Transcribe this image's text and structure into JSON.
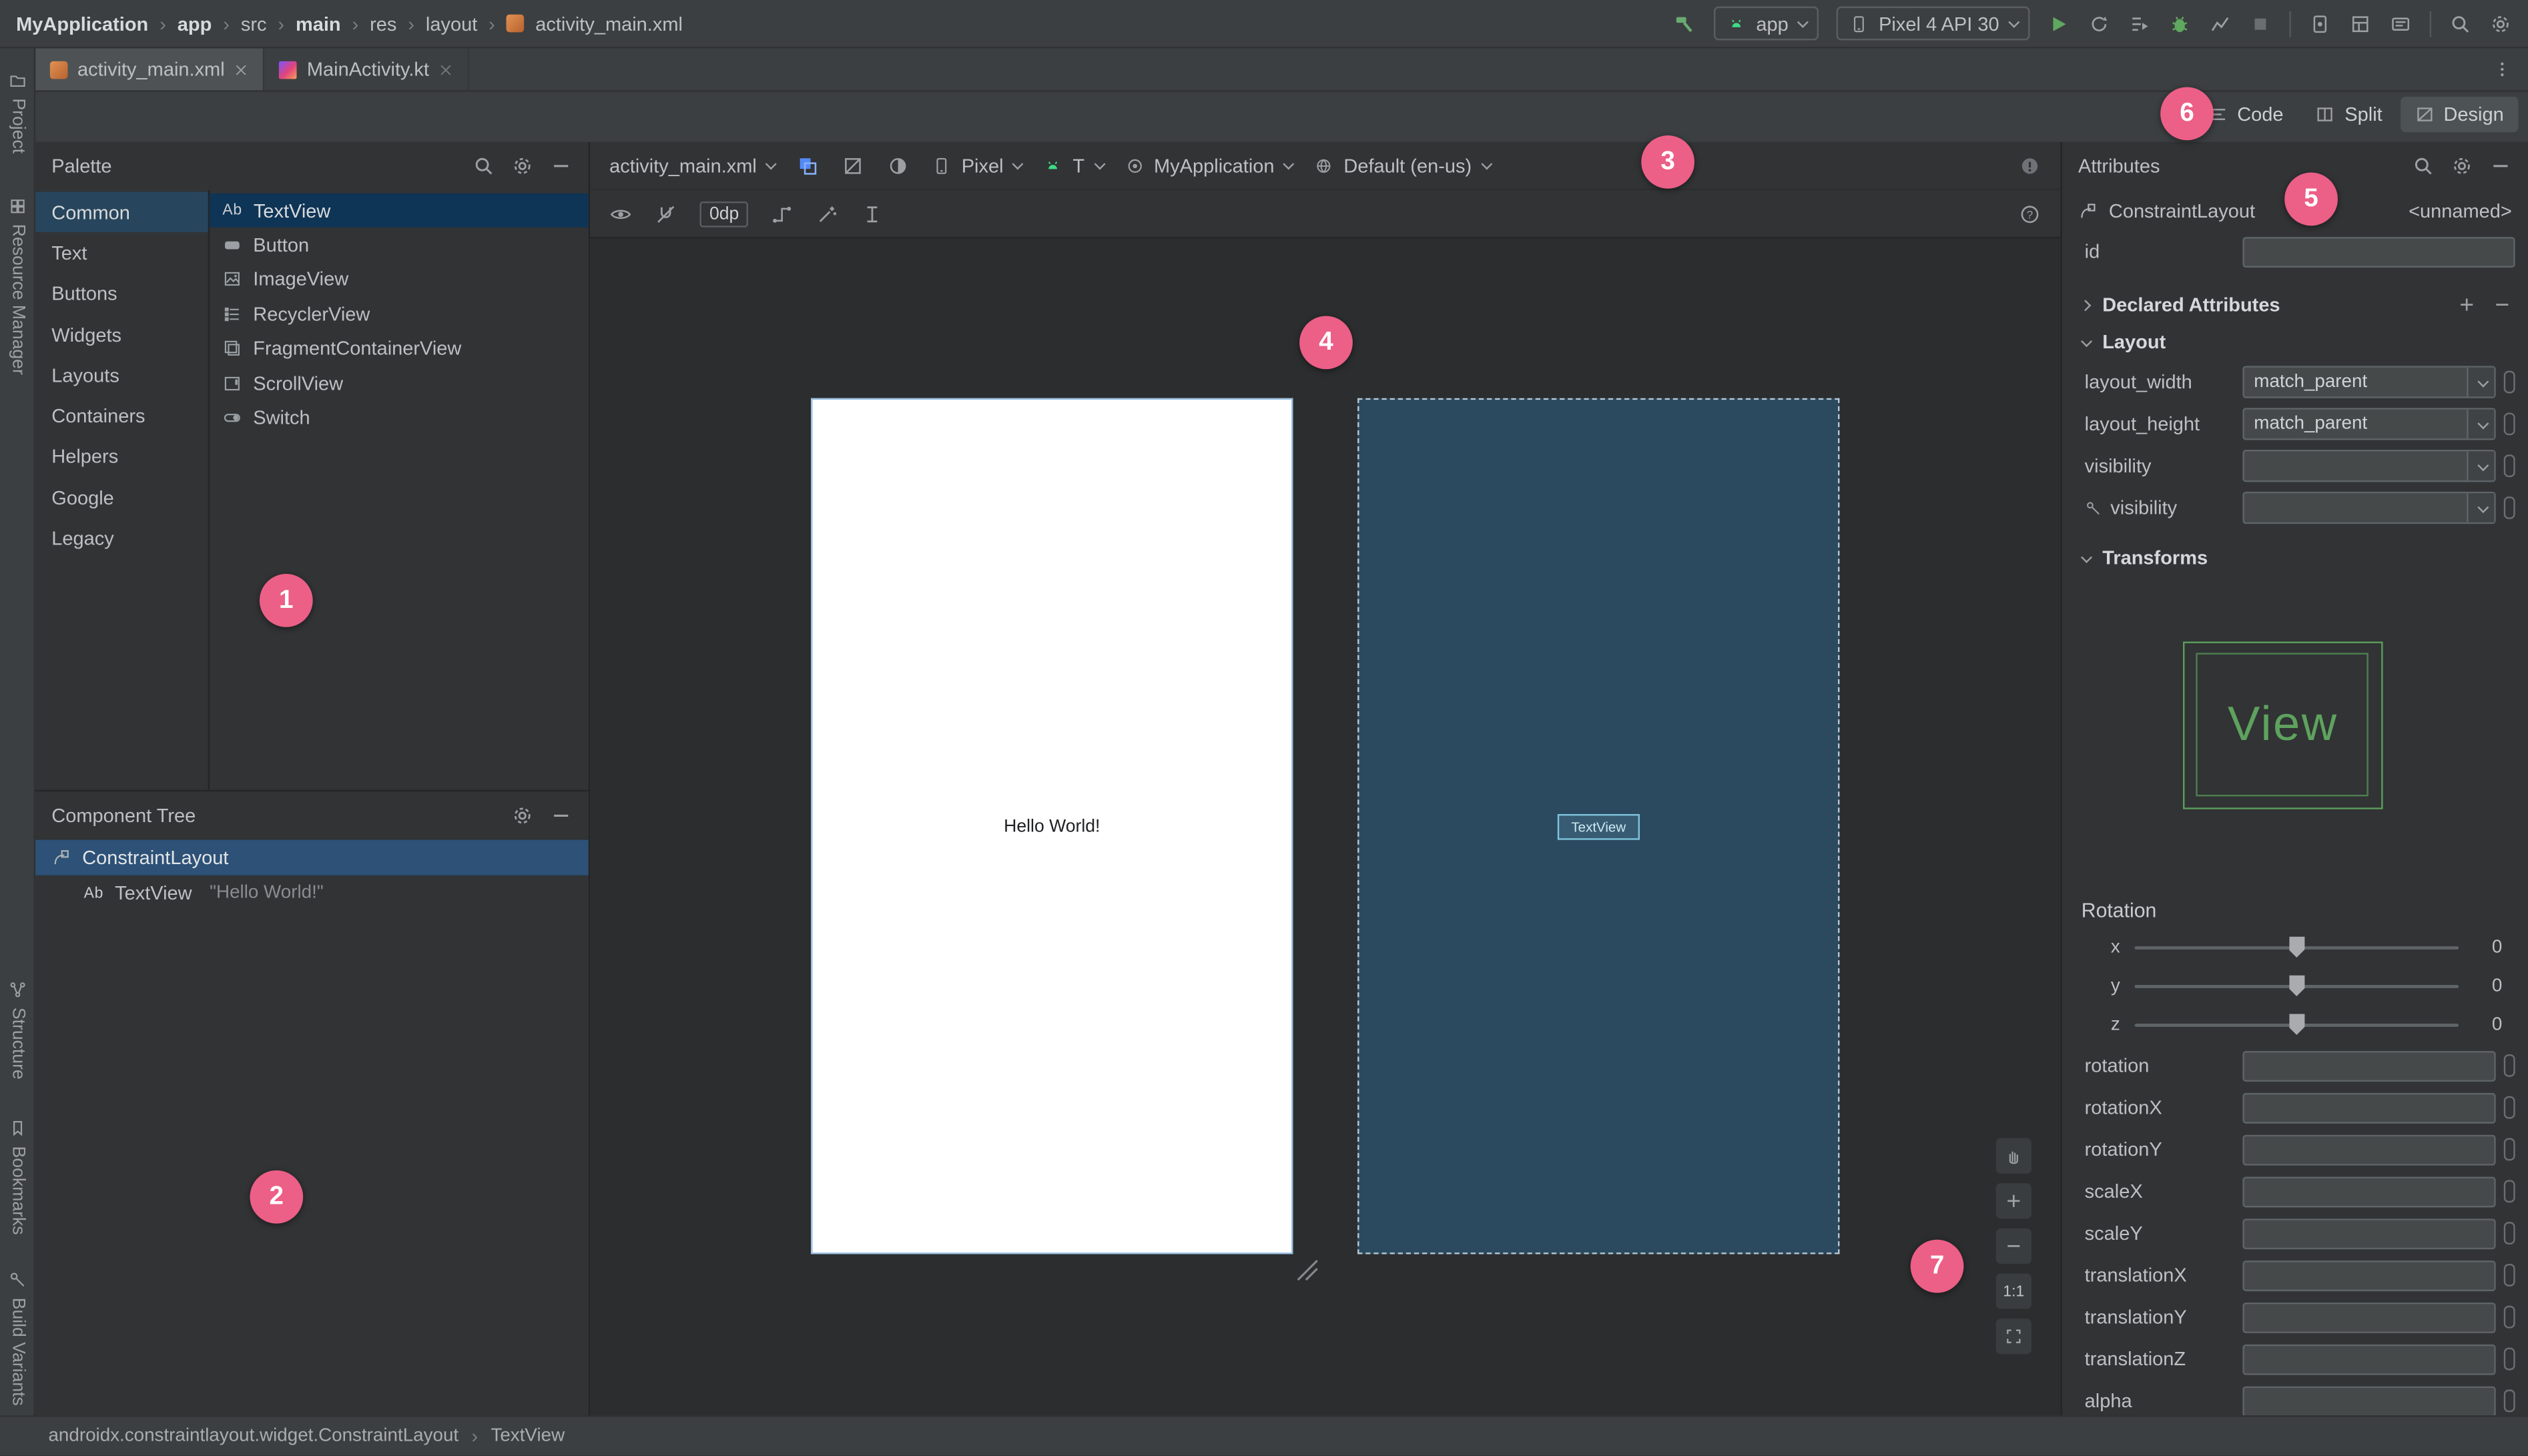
{
  "breadcrumb": {
    "items": [
      "MyApplication",
      "app",
      "src",
      "main",
      "res",
      "layout",
      "activity_main.xml"
    ]
  },
  "run_toolbar": {
    "config": "app",
    "device": "Pixel 4 API 30"
  },
  "editor_tabs": [
    {
      "label": "activity_main.xml"
    },
    {
      "label": "MainActivity.kt"
    }
  ],
  "tool_stripes": {
    "left_top": [
      "Project",
      "Resource Manager"
    ],
    "left_bottom": [
      "Structure",
      "Bookmarks",
      "Build Variants"
    ]
  },
  "view_modes": {
    "options": [
      {
        "label": "Code"
      },
      {
        "label": "Split"
      },
      {
        "label": "Design"
      }
    ],
    "selected": "Design"
  },
  "palette": {
    "title": "Palette",
    "categories": [
      {
        "label": "Common"
      },
      {
        "label": "Text"
      },
      {
        "label": "Buttons"
      },
      {
        "label": "Widgets"
      },
      {
        "label": "Layouts"
      },
      {
        "label": "Containers"
      },
      {
        "label": "Helpers"
      },
      {
        "label": "Google"
      },
      {
        "label": "Legacy"
      }
    ],
    "selected_category": "Common",
    "items": [
      {
        "label": "TextView"
      },
      {
        "label": "Button"
      },
      {
        "label": "ImageView"
      },
      {
        "label": "RecyclerView"
      },
      {
        "label": "FragmentContainerView"
      },
      {
        "label": "ScrollView"
      },
      {
        "label": "Switch"
      }
    ],
    "selected_item": "TextView",
    "textview_icon": "Ab"
  },
  "component_tree": {
    "title": "Component Tree",
    "rows": [
      {
        "label": "ConstraintLayout",
        "detail": ""
      },
      {
        "label": "TextView",
        "detail": "\"Hello World!\"",
        "icon": "Ab"
      }
    ]
  },
  "design_toolbar": {
    "file": "activity_main.xml",
    "device": "Pixel",
    "api": "T",
    "theme": "MyApplication",
    "locale": "Default (en-us)",
    "margin": "0dp"
  },
  "canvas": {
    "design_preview_text": "Hello World!",
    "blueprint_widget_label": "TextView",
    "zoom_label": "1:1"
  },
  "attributes": {
    "title": "Attributes",
    "component": "ConstraintLayout",
    "component_id": "<unnamed>",
    "id_label": "id",
    "id_value": "",
    "declared_attributes_label": "Declared Attributes",
    "layout_section": "Layout",
    "layout_rows": [
      {
        "label": "layout_width",
        "value": "match_parent"
      },
      {
        "label": "layout_height",
        "value": "match_parent"
      },
      {
        "label": "visibility",
        "value": ""
      },
      {
        "label": "visibility",
        "value": ""
      }
    ],
    "transforms_section": "Transforms",
    "view_preview_label": "View",
    "rotation_label": "Rotation",
    "sliders": [
      {
        "axis": "x",
        "value": "0"
      },
      {
        "axis": "y",
        "value": "0"
      },
      {
        "axis": "z",
        "value": "0"
      }
    ],
    "transform_fields": [
      {
        "label": "rotation"
      },
      {
        "label": "rotationX"
      },
      {
        "label": "rotationY"
      },
      {
        "label": "scaleX"
      },
      {
        "label": "scaleY"
      },
      {
        "label": "translationX"
      },
      {
        "label": "translationY"
      },
      {
        "label": "translationZ"
      },
      {
        "label": "alpha"
      }
    ]
  },
  "status_bar": {
    "path": "androidx.constraintlayout.widget.ConstraintLayout",
    "node": "TextView"
  },
  "badges": [
    {
      "n": "1"
    },
    {
      "n": "2"
    },
    {
      "n": "3"
    },
    {
      "n": "4"
    },
    {
      "n": "5"
    },
    {
      "n": "6"
    },
    {
      "n": "7"
    }
  ]
}
